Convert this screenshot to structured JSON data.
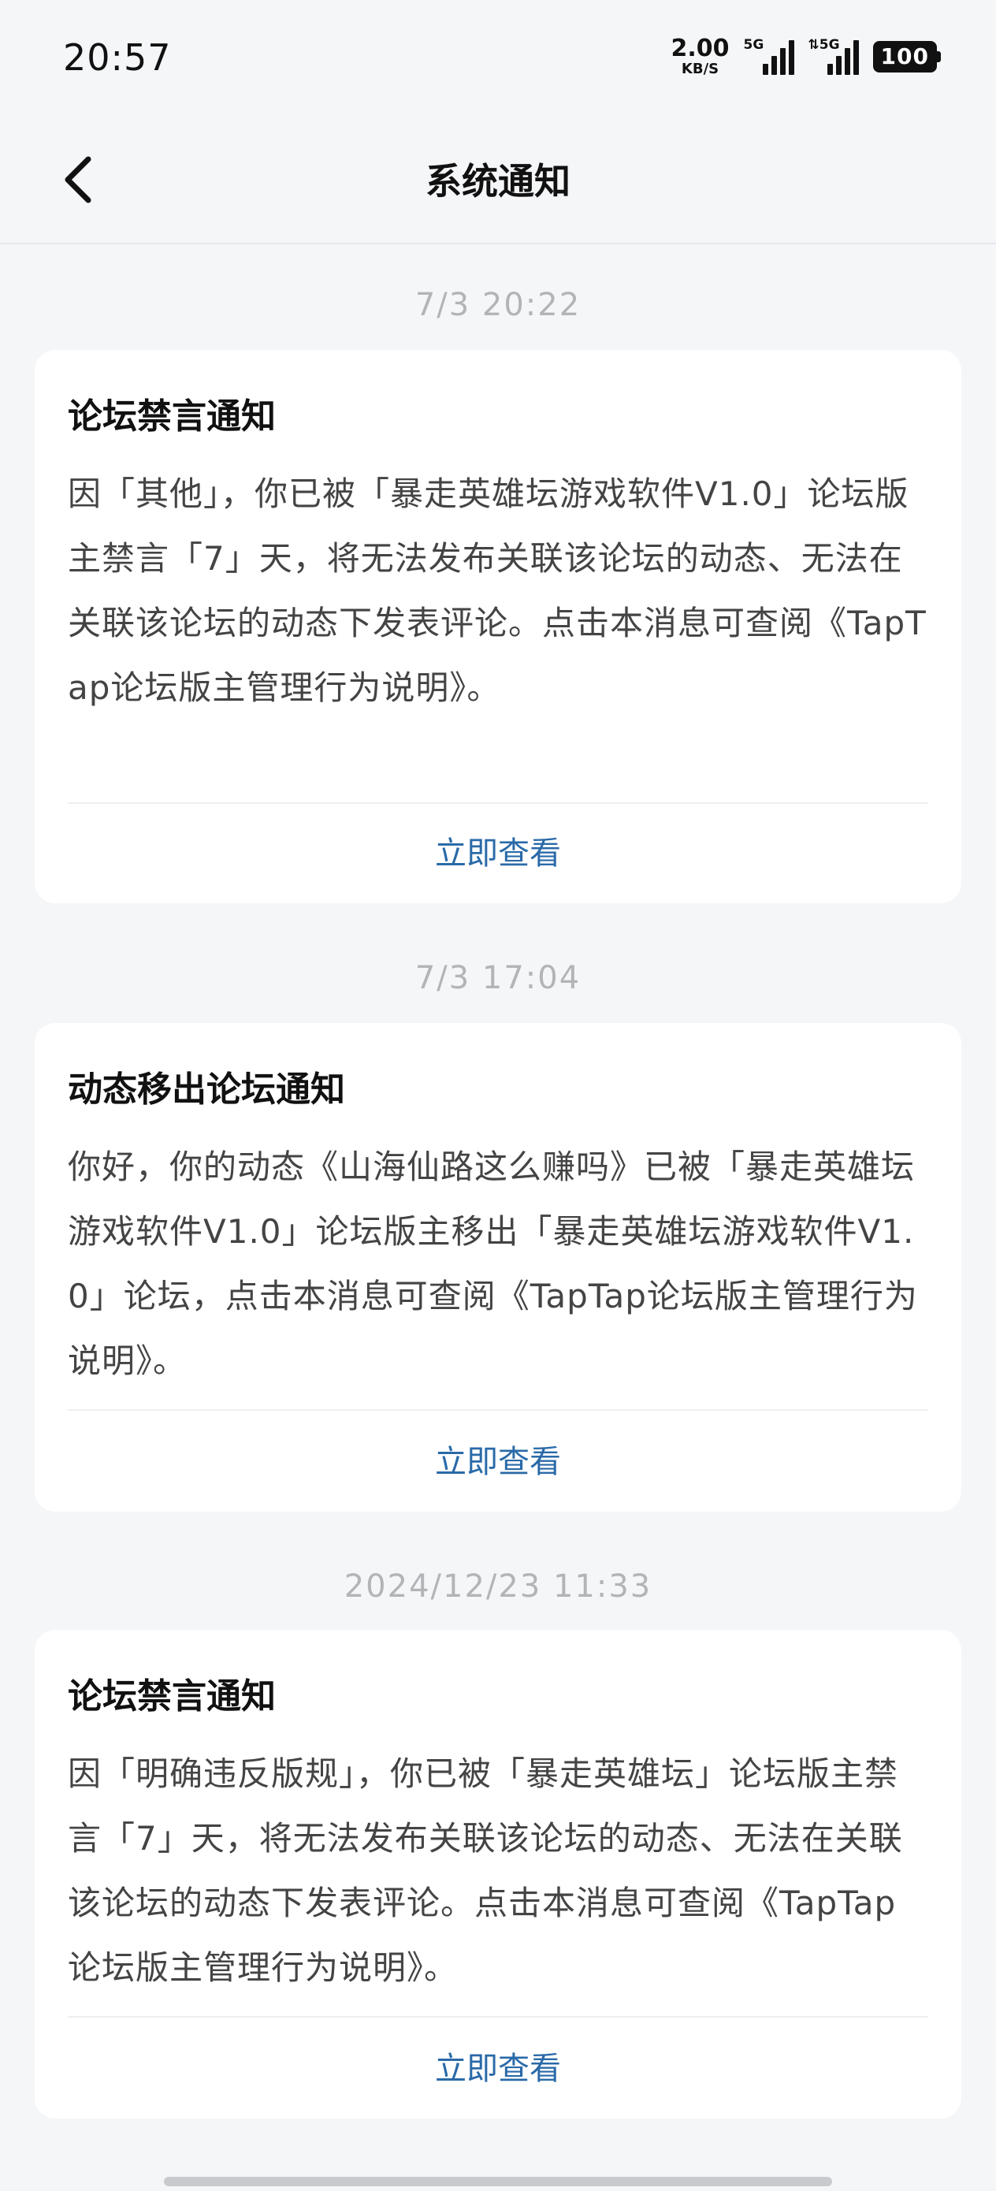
{
  "status_bar": {
    "time": "20:57",
    "net_speed_value": "2.00",
    "net_speed_unit": "KB/S",
    "sim1_tag": "5G",
    "sim2_tag": "⇅5G",
    "battery": "100"
  },
  "header": {
    "back_icon": "chevron-left-icon",
    "title": "系统通知"
  },
  "notifications": [
    {
      "timestamp": "7/3  20:22",
      "title": "论坛禁言通知",
      "body": "因「其他」，你已被「暴走英雄坛游戏软件V1.0」论坛版主禁言「7」天，将无法发布关联该论坛的动态、无法在关联该论坛的动态下发表评论。点击本消息可查阅《TapTap论坛版主管理行为说明》。",
      "action": "立即查看"
    },
    {
      "timestamp": "7/3  17:04",
      "title": "动态移出论坛通知",
      "body": "你好，你的动态《山海仙路这么赚吗》已被「暴走英雄坛游戏软件V1.0」论坛版主移出「暴走英雄坛游戏软件V1.0」论坛，点击本消息可查阅《TapTap论坛版主管理行为说明》。",
      "action": "立即查看"
    },
    {
      "timestamp": "2024/12/23  11:33",
      "title": "论坛禁言通知",
      "body": "因「明确违反版规」，你已被「暴走英雄坛」论坛版主禁言「7」天，将无法发布关联该论坛的动态、无法在关联该论坛的动态下发表评论。点击本消息可查阅《TapTap论坛版主管理行为说明》。",
      "action": "立即查看"
    }
  ]
}
